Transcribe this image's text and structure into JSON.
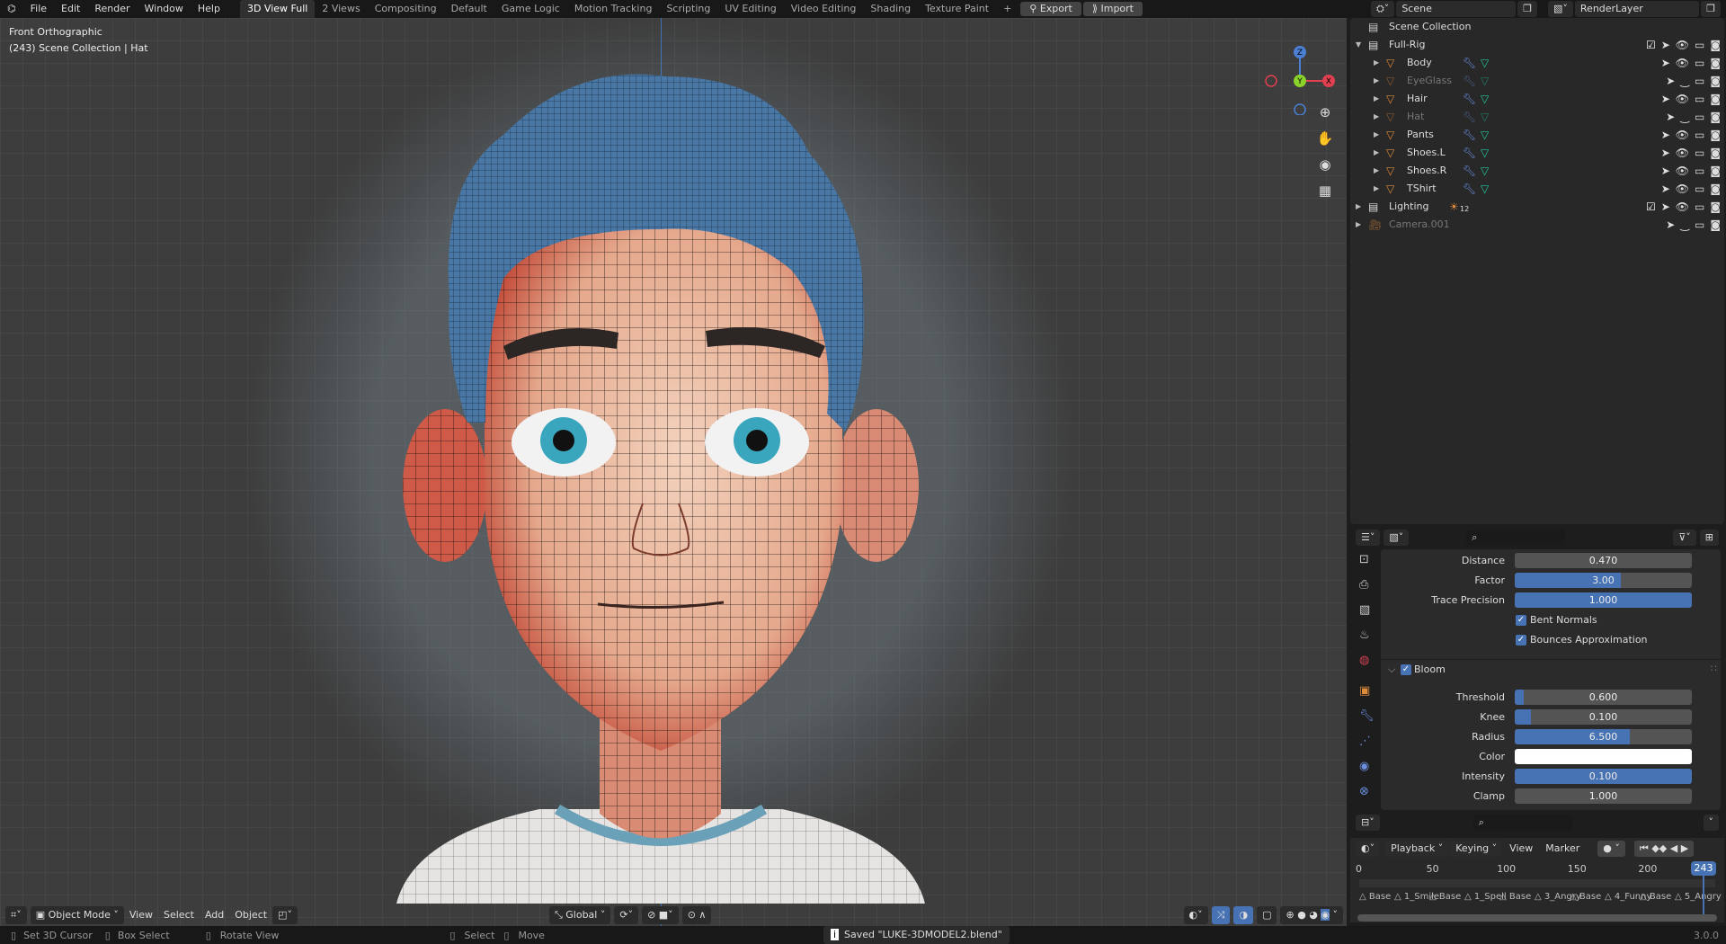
{
  "topbar": {
    "menus": [
      "File",
      "Edit",
      "Render",
      "Window",
      "Help"
    ],
    "workspaces": [
      "3D View Full",
      "2 Views",
      "Compositing",
      "Default",
      "Game Logic",
      "Motion Tracking",
      "Scripting",
      "UV Editing",
      "Video Editing",
      "Shading",
      "Texture Paint"
    ],
    "add": "+",
    "export": "Export",
    "import": "Import",
    "scene": "Scene",
    "render_layer": "RenderLayer"
  },
  "viewport": {
    "view_name": "Front Orthographic",
    "context": "(243) Scene Collection | Hat",
    "gizmo": {
      "x": "X",
      "y": "Y",
      "z": "Z"
    },
    "header": {
      "mode": "Object Mode",
      "menus": [
        "View",
        "Select",
        "Add",
        "Object"
      ],
      "orientation": "Global"
    }
  },
  "outliner": {
    "root": "Scene Collection",
    "rows": [
      {
        "name": "Full-Rig",
        "type": "collection"
      },
      {
        "name": "Body",
        "type": "mesh"
      },
      {
        "name": "EyeGlass",
        "type": "mesh",
        "hidden": true
      },
      {
        "name": "Hair",
        "type": "mesh"
      },
      {
        "name": "Hat",
        "type": "mesh",
        "hidden": true
      },
      {
        "name": "Pants",
        "type": "mesh"
      },
      {
        "name": "Shoes.L",
        "type": "mesh"
      },
      {
        "name": "Shoes.R",
        "type": "mesh"
      },
      {
        "name": "TShirt",
        "type": "mesh"
      },
      {
        "name": "Lighting",
        "type": "collection",
        "badge": "12"
      },
      {
        "name": "Camera.001",
        "type": "camera",
        "hidden": true
      }
    ]
  },
  "properties": {
    "fields": [
      {
        "label": "Distance",
        "value": "0.470",
        "fill": 0
      },
      {
        "label": "Factor",
        "value": "3.00",
        "fill": 0.6
      },
      {
        "label": "Trace Precision",
        "value": "1.000",
        "fill": 1
      }
    ],
    "checks": [
      "Bent Normals",
      "Bounces Approximation"
    ],
    "bloom": {
      "title": "Bloom",
      "fields": [
        {
          "label": "Threshold",
          "value": "0.600",
          "fill": 0.05
        },
        {
          "label": "Knee",
          "value": "0.100",
          "fill": 0.09
        },
        {
          "label": "Radius",
          "value": "6.500",
          "fill": 0.65
        },
        {
          "label": "Color",
          "value": "",
          "color": "#ffffff"
        },
        {
          "label": "Intensity",
          "value": "0.100",
          "fill": 1
        },
        {
          "label": "Clamp",
          "value": "1.000",
          "fill": 0
        }
      ]
    }
  },
  "timeline": {
    "menus": [
      "Playback",
      "Keying",
      "View",
      "Marker"
    ],
    "ticks": [
      "0",
      "50",
      "100",
      "150",
      "200"
    ],
    "current_frame": "243",
    "markers": [
      "Base",
      "1_Smile",
      "Base",
      "1_Spell",
      "Base",
      "3_Angry",
      "Base",
      "4_Funny",
      "Base",
      "5_Angry"
    ]
  },
  "status": {
    "items": [
      "Set 3D Cursor",
      "Box Select",
      "Rotate View",
      "Select",
      "Move"
    ],
    "message": "Saved \"LUKE-3DMODEL2.blend\"",
    "version": "3.0.0"
  },
  "colors": {
    "accent": "#4772b3",
    "mesh": "#e08a3c",
    "modifier": "#6a8fe0",
    "data": "#20c8a0"
  }
}
